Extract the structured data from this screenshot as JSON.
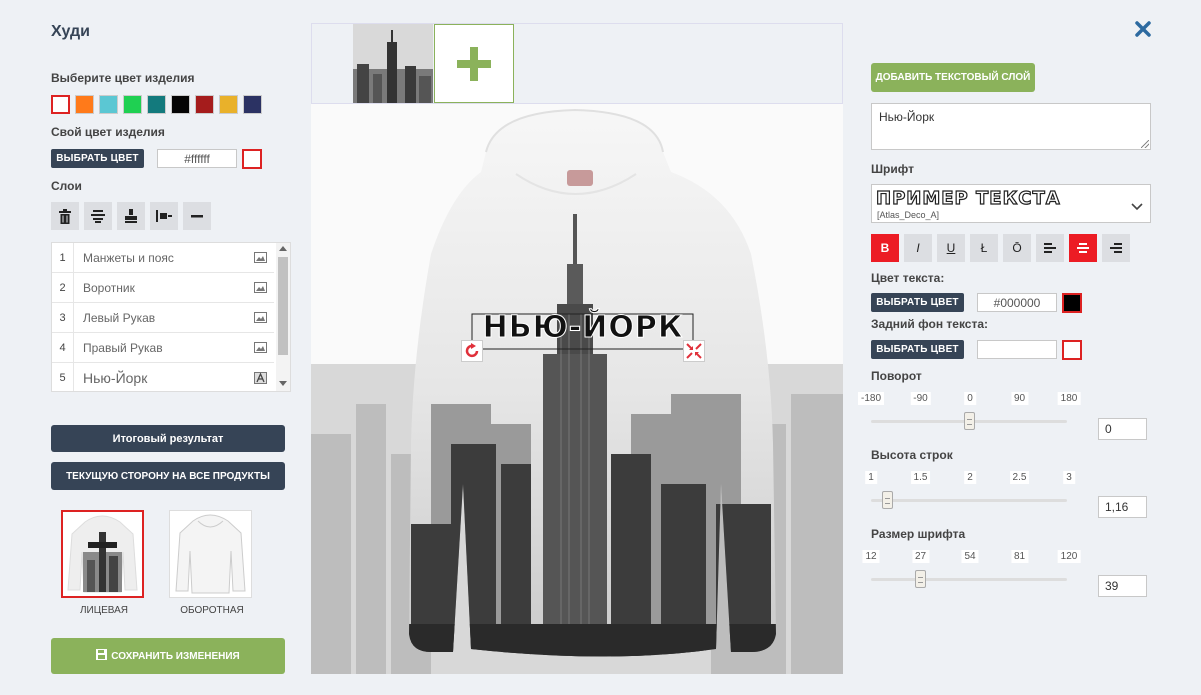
{
  "title": "Худи",
  "close_icon": "close-icon",
  "left": {
    "color_label": "Выберите цвет изделия",
    "swatches": [
      "#ffffff",
      "#ff7a1a",
      "#5bc7d3",
      "#1fd052",
      "#137a7d",
      "#050505",
      "#a51c1c",
      "#e9b12a",
      "#2b3263"
    ],
    "custom_color_label": "Свой цвет изделия",
    "pick_color_button": "ВЫБРАТЬ ЦВЕТ",
    "custom_color_value": "#ffffff",
    "layers_label": "Слои",
    "layers": [
      {
        "num": "1",
        "name": "Манжеты и пояс",
        "type": "image-icon"
      },
      {
        "num": "2",
        "name": "Воротник",
        "type": "image-icon"
      },
      {
        "num": "3",
        "name": "Левый Рукав",
        "type": "image-icon"
      },
      {
        "num": "4",
        "name": "Правый Рукав",
        "type": "image-icon"
      },
      {
        "num": "5",
        "name": "Нью-Йорк",
        "type": "text-icon"
      }
    ],
    "result_button": "Итоговый результат",
    "apply_all_button": "ТЕКУЩУЮ СТОРОНУ НА ВСЕ ПРОДУКТЫ",
    "front_label": "ЛИЦЕВАЯ",
    "back_label": "ОБОРОТНАЯ",
    "save_button": "СОХРАНИТЬ ИЗМЕНЕНИЯ"
  },
  "canvas": {
    "overlay_text": "НЬЮ-ЙОРК",
    "rotate_icon": "rotate-icon",
    "resize_icon": "resize-icon",
    "add_icon": "plus-icon"
  },
  "right": {
    "add_text_button": "ДОБАВИТЬ ТЕКСТОВЫЙ СЛОЙ",
    "text_value": "Нью-Йорк",
    "font_label": "Шрифт",
    "font_preview": "ПРИМЕР ТЕКСТА",
    "font_name": "[Atlas_Deco_A]",
    "format_buttons": [
      "B",
      "I",
      "U",
      "Ł",
      "Ō",
      "align-left",
      "align-center",
      "align-right"
    ],
    "text_color_label": "Цвет текста:",
    "pick_color_button": "ВЫБРАТЬ ЦВЕТ",
    "text_color_value": "#000000",
    "bg_label": "Задний фон текста:",
    "bg_pick_button": "ВЫБРАТЬ ЦВЕТ",
    "bg_value": "",
    "rotation": {
      "label": "Поворот",
      "ticks": [
        "-180",
        "-90",
        "0",
        "90",
        "180"
      ],
      "value": "0",
      "level": 0.5
    },
    "line_height": {
      "label": "Высота строк",
      "ticks": [
        "1",
        "1.5",
        "2",
        "2.5",
        "3"
      ],
      "value": "1,16",
      "level": 0.08
    },
    "font_size": {
      "label": "Размер шрифта",
      "ticks": [
        "12",
        "27",
        "54",
        "81",
        "120"
      ],
      "value": "39",
      "level": 0.25
    }
  }
}
